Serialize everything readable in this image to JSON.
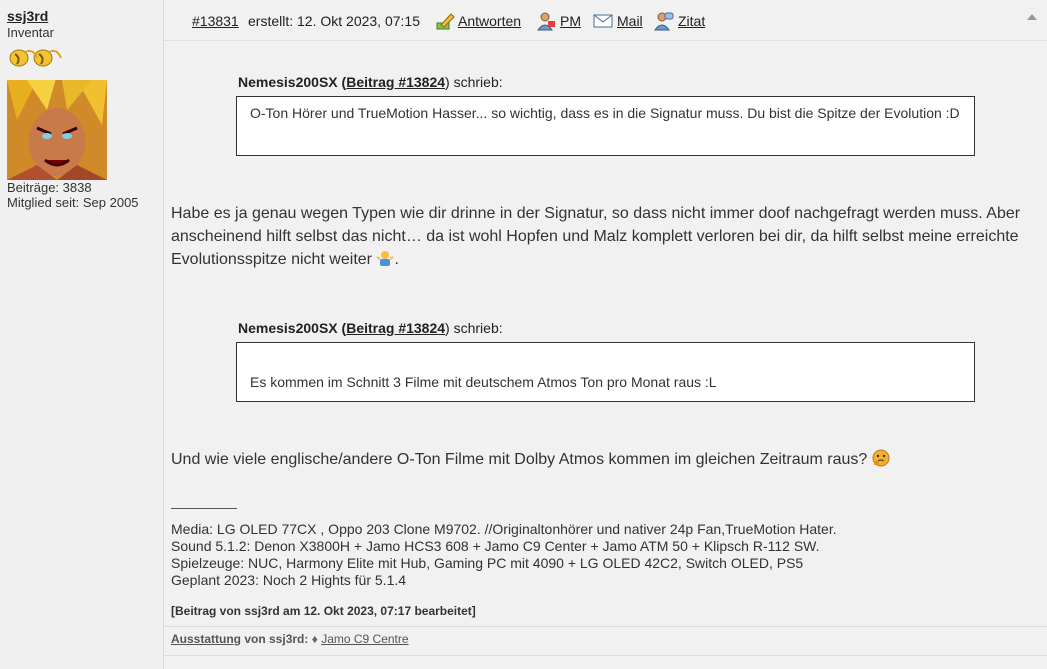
{
  "author": {
    "username": "ssj3rd",
    "rank": "Inventar",
    "posts": "Beiträge: 3838",
    "member_since": "Mitglied seit: Sep 2005"
  },
  "post_header": {
    "post_number": "#13831",
    "created": "erstellt: 12. Okt 2023, 07:15",
    "reply": "Antworten",
    "pm": "PM",
    "mail": "Mail",
    "quote": "Zitat"
  },
  "quotes": [
    {
      "author": "Nemesis200SX",
      "open_paren": "(",
      "link": "Beitrag #13824",
      "close_said": ") schrieb:",
      "text": "O-Ton Hörer und TrueMotion Hasser... so wichtig, dass es in die Signatur muss. Du bist die Spitze der Evolution :D"
    },
    {
      "author": "Nemesis200SX",
      "open_paren": "(",
      "link": "Beitrag #13824",
      "close_said": ") schrieb:",
      "text": "Es kommen im Schnitt 3 Filme mit deutschem Atmos Ton pro Monat raus :L"
    }
  ],
  "body": {
    "paragraph1": "Habe es ja genau wegen Typen wie dir drinne in der Signatur, so dass nicht immer doof nachgefragt werden muss. Aber anscheinend hilft selbst das nicht… da ist wohl Hopfen und Malz komplett verloren bei dir, da hilft selbst meine erreichte Evolutionsspitze nicht weiter",
    "paragraph1_end": ".",
    "paragraph2": "Und wie viele englische/andere O-Ton Filme mit Dolby Atmos kommen im gleichen Zeitraum raus?"
  },
  "signature": {
    "lines": [
      "Media: LG OLED 77CX , Oppo 203 Clone M9702. //Originaltonhörer und nativer 24p Fan,TrueMotion Hater.",
      "Sound 5.1.2: Denon X3800H + Jamo HCS3 608 + Jamo C9 Center + Jamo ATM 50 + Klipsch R-112 SW.",
      "Spielzeuge: NUC, Harmony Elite mit Hub, Gaming PC mit 4090 + LG OLED 42C2, Switch OLED, PS5",
      "Geplant 2023: Noch 2 Hights für 5.1.4"
    ]
  },
  "edited": "[Beitrag von ssj3rd am 12. Okt 2023, 07:17 bearbeitet]",
  "footer": {
    "label": "Ausstattung",
    "by": "von ssj3rd:",
    "bullet": "♦",
    "item": "Jamo C9 Centre"
  },
  "colors": {
    "background": "#f1f1f1",
    "quote_border": "#333333",
    "text": "#333333"
  }
}
